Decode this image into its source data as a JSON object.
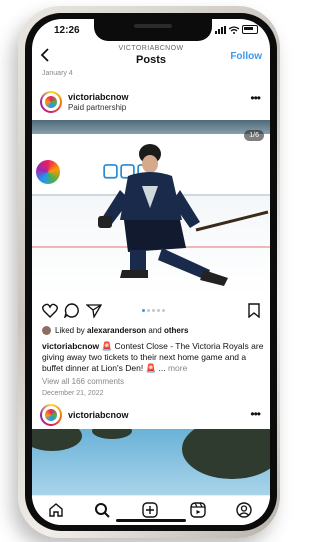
{
  "status_bar": {
    "time": "12:26"
  },
  "nav": {
    "username": "VICTORIABCNOW",
    "title": "Posts",
    "follow_label": "Follow"
  },
  "prev_date": "January 4",
  "post": {
    "username": "victoriabcnow",
    "subtitle": "Paid partnership",
    "image_counter": "1/6",
    "liked_prefix": "Liked by ",
    "liked_user": "alexaranderson",
    "liked_and": " and ",
    "liked_others": "others",
    "caption_user": "victoriabcnow",
    "caption_text": " 🚨 Contest Close - The Victoria Royals are giving away two tickets to their next home game and a buffet dinner at Lion's Den! 🚨 ...",
    "caption_more": " more",
    "comments_label": "View all 166 comments",
    "date": "December 21, 2022"
  },
  "post2": {
    "username": "victoriabcnow"
  },
  "carousel": {
    "total_dots": 5,
    "active_index": 0
  },
  "colors": {
    "accent": "#3b97f0",
    "text": "#111111",
    "muted": "#888888"
  }
}
